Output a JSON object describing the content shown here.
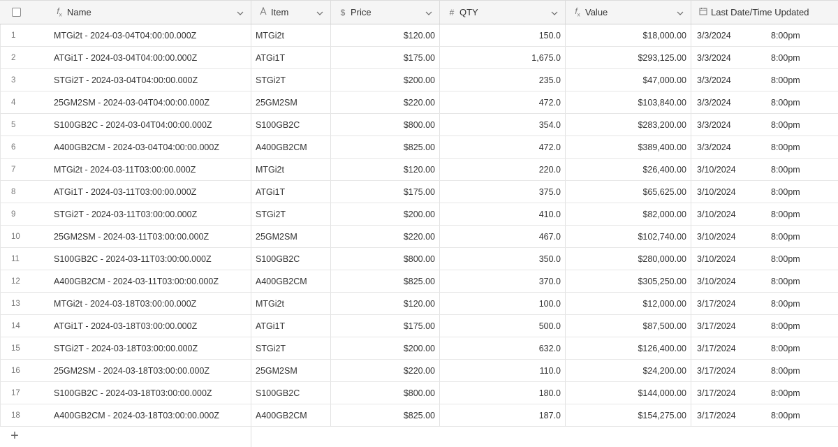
{
  "headers": {
    "name": "Name",
    "item": "Item",
    "price": "Price",
    "qty": "QTY",
    "value": "Value",
    "date": "Last Date/Time Updated"
  },
  "header_icons": {
    "name": "formula-icon",
    "item": "text-field-icon",
    "price": "currency-icon",
    "qty": "number-icon",
    "value": "formula-icon",
    "date": "calendar-icon"
  },
  "rows": [
    {
      "num": "1",
      "name": "MTGi2t - 2024-03-04T04:00:00.000Z",
      "item": "MTGi2t",
      "price": "$120.00",
      "qty": "150.0",
      "value": "$18,000.00",
      "date": "3/3/2024",
      "time": "8:00pm"
    },
    {
      "num": "2",
      "name": "ATGi1T - 2024-03-04T04:00:00.000Z",
      "item": "ATGi1T",
      "price": "$175.00",
      "qty": "1,675.0",
      "value": "$293,125.00",
      "date": "3/3/2024",
      "time": "8:00pm"
    },
    {
      "num": "3",
      "name": "STGi2T - 2024-03-04T04:00:00.000Z",
      "item": "STGi2T",
      "price": "$200.00",
      "qty": "235.0",
      "value": "$47,000.00",
      "date": "3/3/2024",
      "time": "8:00pm"
    },
    {
      "num": "4",
      "name": "25GM2SM - 2024-03-04T04:00:00.000Z",
      "item": "25GM2SM",
      "price": "$220.00",
      "qty": "472.0",
      "value": "$103,840.00",
      "date": "3/3/2024",
      "time": "8:00pm"
    },
    {
      "num": "5",
      "name": "S100GB2C - 2024-03-04T04:00:00.000Z",
      "item": "S100GB2C",
      "price": "$800.00",
      "qty": "354.0",
      "value": "$283,200.00",
      "date": "3/3/2024",
      "time": "8:00pm"
    },
    {
      "num": "6",
      "name": "A400GB2CM - 2024-03-04T04:00:00.000Z",
      "item": "A400GB2CM",
      "price": "$825.00",
      "qty": "472.0",
      "value": "$389,400.00",
      "date": "3/3/2024",
      "time": "8:00pm"
    },
    {
      "num": "7",
      "name": "MTGi2t - 2024-03-11T03:00:00.000Z",
      "item": "MTGi2t",
      "price": "$120.00",
      "qty": "220.0",
      "value": "$26,400.00",
      "date": "3/10/2024",
      "time": "8:00pm"
    },
    {
      "num": "8",
      "name": "ATGi1T - 2024-03-11T03:00:00.000Z",
      "item": "ATGi1T",
      "price": "$175.00",
      "qty": "375.0",
      "value": "$65,625.00",
      "date": "3/10/2024",
      "time": "8:00pm"
    },
    {
      "num": "9",
      "name": "STGi2T - 2024-03-11T03:00:00.000Z",
      "item": "STGi2T",
      "price": "$200.00",
      "qty": "410.0",
      "value": "$82,000.00",
      "date": "3/10/2024",
      "time": "8:00pm"
    },
    {
      "num": "10",
      "name": "25GM2SM - 2024-03-11T03:00:00.000Z",
      "item": "25GM2SM",
      "price": "$220.00",
      "qty": "467.0",
      "value": "$102,740.00",
      "date": "3/10/2024",
      "time": "8:00pm"
    },
    {
      "num": "11",
      "name": "S100GB2C - 2024-03-11T03:00:00.000Z",
      "item": "S100GB2C",
      "price": "$800.00",
      "qty": "350.0",
      "value": "$280,000.00",
      "date": "3/10/2024",
      "time": "8:00pm"
    },
    {
      "num": "12",
      "name": "A400GB2CM - 2024-03-11T03:00:00.000Z",
      "item": "A400GB2CM",
      "price": "$825.00",
      "qty": "370.0",
      "value": "$305,250.00",
      "date": "3/10/2024",
      "time": "8:00pm"
    },
    {
      "num": "13",
      "name": "MTGi2t - 2024-03-18T03:00:00.000Z",
      "item": "MTGi2t",
      "price": "$120.00",
      "qty": "100.0",
      "value": "$12,000.00",
      "date": "3/17/2024",
      "time": "8:00pm"
    },
    {
      "num": "14",
      "name": "ATGi1T - 2024-03-18T03:00:00.000Z",
      "item": "ATGi1T",
      "price": "$175.00",
      "qty": "500.0",
      "value": "$87,500.00",
      "date": "3/17/2024",
      "time": "8:00pm"
    },
    {
      "num": "15",
      "name": "STGi2T - 2024-03-18T03:00:00.000Z",
      "item": "STGi2T",
      "price": "$200.00",
      "qty": "632.0",
      "value": "$126,400.00",
      "date": "3/17/2024",
      "time": "8:00pm"
    },
    {
      "num": "16",
      "name": "25GM2SM - 2024-03-18T03:00:00.000Z",
      "item": "25GM2SM",
      "price": "$220.00",
      "qty": "110.0",
      "value": "$24,200.00",
      "date": "3/17/2024",
      "time": "8:00pm"
    },
    {
      "num": "17",
      "name": "S100GB2C - 2024-03-18T03:00:00.000Z",
      "item": "S100GB2C",
      "price": "$800.00",
      "qty": "180.0",
      "value": "$144,000.00",
      "date": "3/17/2024",
      "time": "8:00pm"
    },
    {
      "num": "18",
      "name": "A400GB2CM - 2024-03-18T03:00:00.000Z",
      "item": "A400GB2CM",
      "price": "$825.00",
      "qty": "187.0",
      "value": "$154,275.00",
      "date": "3/17/2024",
      "time": "8:00pm"
    }
  ],
  "footer": {
    "add_icon": "plus-icon"
  }
}
